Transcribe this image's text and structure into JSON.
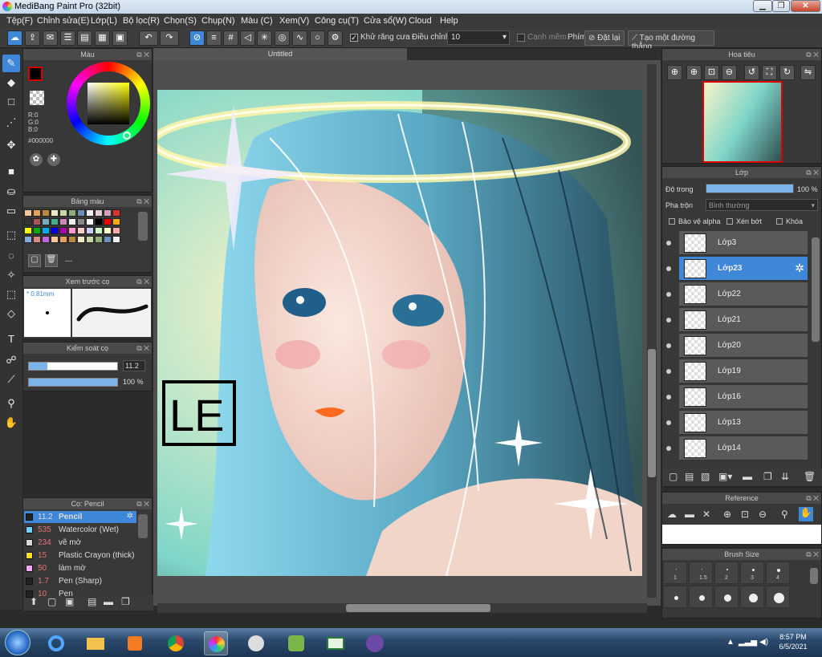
{
  "window": {
    "title": "MediBang Paint Pro (32bit)",
    "minimize": "▁",
    "maximize": "❐",
    "close": "✕"
  },
  "menu": [
    "Tệp(F)",
    "Chỉnh sửa(E)",
    "Lớp(L)",
    "Bộ lọc(R)",
    "Chọn(S)",
    "Chụp(N)",
    "Màu (C)",
    "Xem(V)",
    "Công cụ(T)",
    "Cửa sổ(W)",
    "Cloud",
    "Help"
  ],
  "toolbar": {
    "antialias_label": "Khử răng cưa",
    "adjust_label": "Điều chỉnh",
    "adjust_value": "10",
    "edge_label": "Cạnh mềm",
    "key_label": "Phím",
    "reset_label": "Đặt lại",
    "line_label": "Tạo một đường thẳng"
  },
  "color_panel": {
    "title": "Màu",
    "r": "R:0",
    "g": "G:0",
    "b": "B:0",
    "hex": "#000000"
  },
  "palette_panel": {
    "title": "Bảng màu",
    "extra": "---"
  },
  "preview_panel": {
    "title": "Xem trước cọ",
    "size": "* 0.81mm"
  },
  "brush_control": {
    "title": "Kiểm soát cọ",
    "size_value": "11.2",
    "opacity_value": "100 %",
    "size_fraction": 0.21,
    "opacity_fraction": 1.0
  },
  "brush_list": {
    "title": "Cọ: Pencil",
    "items": [
      {
        "value": "11.2",
        "name": "Pencil",
        "color": "#222222",
        "selected": true
      },
      {
        "value": "535",
        "name": "Watercolor (Wet)",
        "color": "#6fd3ff"
      },
      {
        "value": "234",
        "name": "vẽ mờ",
        "color": "#d8d8d8"
      },
      {
        "value": "15",
        "name": "Plastic Crayon (thick)",
        "color": "#f5e11a"
      },
      {
        "value": "50",
        "name": "làm mờ",
        "color": "#f4a6f0"
      },
      {
        "value": "1.7",
        "name": "Pen (Sharp)",
        "color": "#222222"
      },
      {
        "value": "10",
        "name": "Pen",
        "color": "#222222"
      }
    ]
  },
  "document": {
    "tab": "Untitled"
  },
  "artwork": {
    "signature": "LE"
  },
  "navigator": {
    "title": "Hoa tiêu"
  },
  "layers": {
    "title": "Lớp",
    "opacity_label": "Độ trong",
    "opacity_value": "100 %",
    "opacity_fraction": 1.0,
    "blend_label": "Pha trộn",
    "blend_value": "Bình thường",
    "protect_alpha": "Bảo vệ alpha",
    "clip": "Xén bớt",
    "lock": "Khóa",
    "items": [
      {
        "name": "Lớp3"
      },
      {
        "name": "Lớp23",
        "selected": true
      },
      {
        "name": "Lớp22"
      },
      {
        "name": "Lớp21"
      },
      {
        "name": "Lớp20"
      },
      {
        "name": "Lớp19"
      },
      {
        "name": "Lớp16"
      },
      {
        "name": "Lớp13"
      },
      {
        "name": "Lớp14"
      }
    ]
  },
  "reference": {
    "title": "Reference"
  },
  "brush_size": {
    "title": "Brush Size",
    "labels": [
      "1",
      "1.5",
      "2",
      "3",
      "4"
    ]
  },
  "taskbar": {
    "time": "8:57 PM",
    "date": "6/5/2021"
  }
}
